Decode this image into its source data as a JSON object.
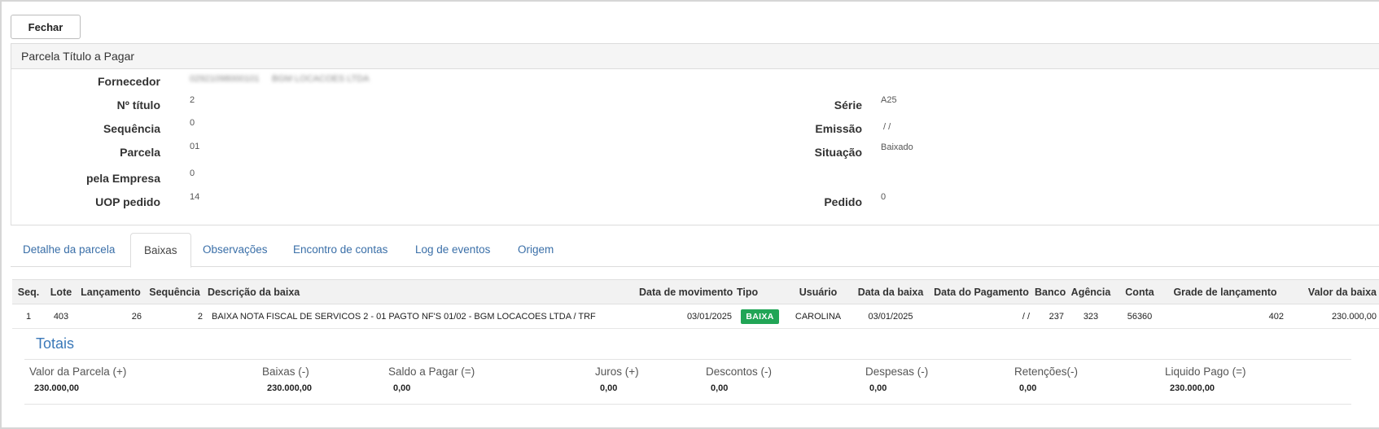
{
  "toolbar": {
    "close_label": "Fechar"
  },
  "panel": {
    "title": "Parcela Título a Pagar",
    "fields": {
      "fornecedor": {
        "label": "Fornecedor",
        "value_code": "02921098000101",
        "value_name": "BGM LOCACOES LTDA"
      },
      "num_titulo": {
        "label": "Nº título",
        "value": "2"
      },
      "sequencia": {
        "label": "Sequência",
        "value": "0"
      },
      "parcela": {
        "label": "Parcela",
        "value": "01"
      },
      "pela_empresa": {
        "label": "pela Empresa",
        "value": "0"
      },
      "uop_pedido": {
        "label": "UOP pedido",
        "value": "14"
      },
      "serie": {
        "label": "Série",
        "value": "A25"
      },
      "emissao": {
        "label": "Emissão",
        "value": " / /"
      },
      "situacao": {
        "label": "Situação",
        "value": "Baixado"
      },
      "pedido": {
        "label": "Pedido",
        "value": "0"
      }
    }
  },
  "tabs": [
    {
      "label": "Detalhe da parcela",
      "active": false
    },
    {
      "label": "Baixas",
      "active": true
    },
    {
      "label": "Observações",
      "active": false
    },
    {
      "label": "Encontro de contas",
      "active": false
    },
    {
      "label": "Log de eventos",
      "active": false
    },
    {
      "label": "Origem",
      "active": false
    }
  ],
  "table": {
    "headers": [
      "Seq.",
      "Lote",
      "Lançamento",
      "Sequência",
      "Descrição da baixa",
      "Data de movimento",
      "Tipo",
      "Usuário",
      "Data da baixa",
      "Data do Pagamento",
      "Banco",
      "Agência",
      "Conta",
      "Grade de lançamento",
      "Valor da baixa"
    ],
    "rows": [
      {
        "seq": "1",
        "lote": "403",
        "lancamento": "26",
        "sequencia": "2",
        "descricao": "BAIXA NOTA FISCAL DE SERVICOS 2 - 01 PAGTO NF'S 01/02 - BGM LOCACOES LTDA / TRF",
        "data_movimento": "03/01/2025",
        "tipo": "BAIXA",
        "usuario": "CAROLINA",
        "data_baixa": "03/01/2025",
        "data_pagamento": "/ /",
        "banco": "237",
        "agencia": "323",
        "conta": "56360",
        "grade": "402",
        "valor": "230.000,00"
      }
    ]
  },
  "totais": {
    "title": "Totais",
    "items": [
      {
        "label": "Valor da Parcela (+)",
        "value": "230.000,00"
      },
      {
        "label": "Baixas (-)",
        "value": "230.000,00"
      },
      {
        "label": "Saldo a Pagar (=)",
        "value": "0,00"
      },
      {
        "label": "Juros (+)",
        "value": "0,00"
      },
      {
        "label": "Descontos (-)",
        "value": "0,00"
      },
      {
        "label": "Despesas (-)",
        "value": "0,00"
      },
      {
        "label": "Retenções(-)",
        "value": "0,00"
      },
      {
        "label": "Liquido Pago (=)",
        "value": "230.000,00"
      }
    ]
  },
  "colors": {
    "link": "#3a6fa8",
    "badge": "#21a556",
    "totais_title": "#3a78b8"
  }
}
